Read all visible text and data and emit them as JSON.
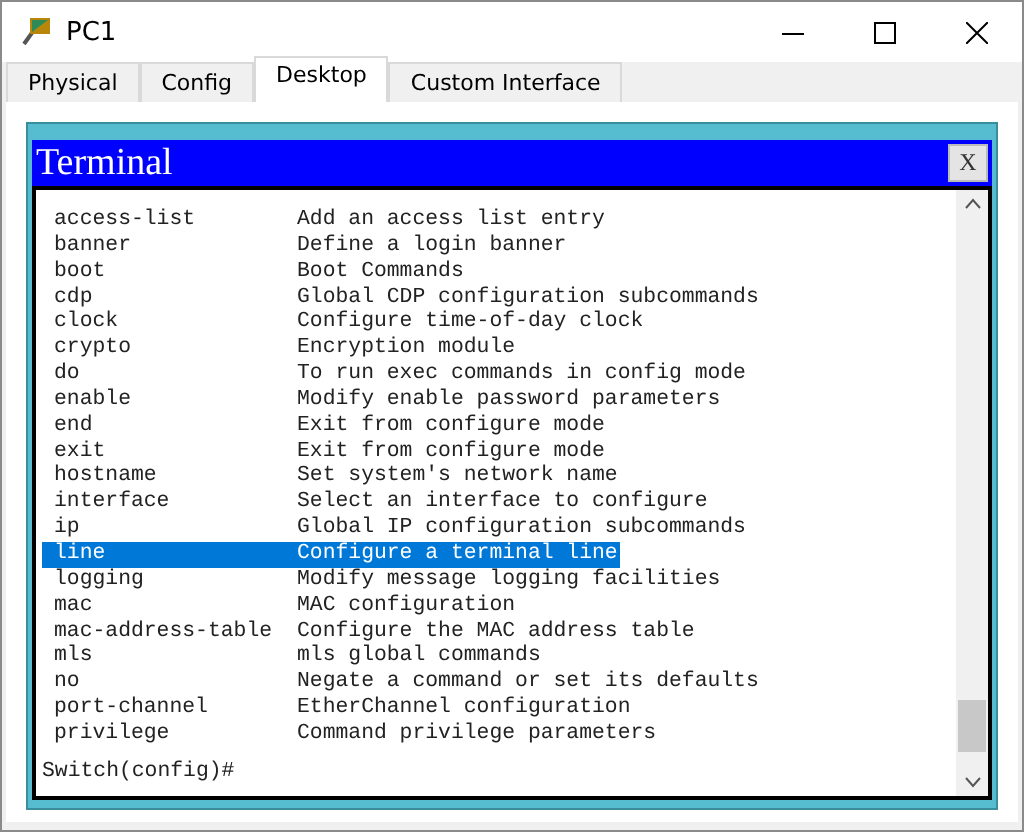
{
  "window": {
    "title": "PC1"
  },
  "tabs": [
    {
      "label": "Physical",
      "selected": false
    },
    {
      "label": "Config",
      "selected": false
    },
    {
      "label": "Desktop",
      "selected": true
    },
    {
      "label": "Custom Interface",
      "selected": false
    }
  ],
  "terminal": {
    "title": "Terminal",
    "close_label": "X",
    "lines": [
      {
        "command": "access-list",
        "description": "Add an access list entry",
        "selected": false
      },
      {
        "command": "banner",
        "description": "Define a login banner",
        "selected": false
      },
      {
        "command": "boot",
        "description": "Boot Commands",
        "selected": false
      },
      {
        "command": "cdp",
        "description": "Global CDP configuration subcommands",
        "selected": false
      },
      {
        "command": "clock",
        "description": "Configure time-of-day clock",
        "selected": false
      },
      {
        "command": "crypto",
        "description": "Encryption module",
        "selected": false
      },
      {
        "command": "do",
        "description": "To run exec commands in config mode",
        "selected": false
      },
      {
        "command": "enable",
        "description": "Modify enable password parameters",
        "selected": false
      },
      {
        "command": "end",
        "description": "Exit from configure mode",
        "selected": false
      },
      {
        "command": "exit",
        "description": "Exit from configure mode",
        "selected": false
      },
      {
        "command": "hostname",
        "description": "Set system's network name",
        "selected": false
      },
      {
        "command": "interface",
        "description": "Select an interface to configure",
        "selected": false
      },
      {
        "command": "ip",
        "description": "Global IP configuration subcommands",
        "selected": false
      },
      {
        "command": "line",
        "description": "Configure a terminal line",
        "selected": true
      },
      {
        "command": "logging",
        "description": "Modify message logging facilities",
        "selected": false
      },
      {
        "command": "mac",
        "description": "MAC configuration",
        "selected": false
      },
      {
        "command": "mac-address-table",
        "description": "Configure the MAC address table",
        "selected": false
      },
      {
        "command": "mls",
        "description": "mls global commands",
        "selected": false
      },
      {
        "command": "no",
        "description": "Negate a command or set its defaults",
        "selected": false
      },
      {
        "command": "port-channel",
        "description": "EtherChannel configuration",
        "selected": false
      },
      {
        "command": "privilege",
        "description": "Command privilege parameters",
        "selected": false
      }
    ],
    "prompt": "Switch(config)#"
  }
}
